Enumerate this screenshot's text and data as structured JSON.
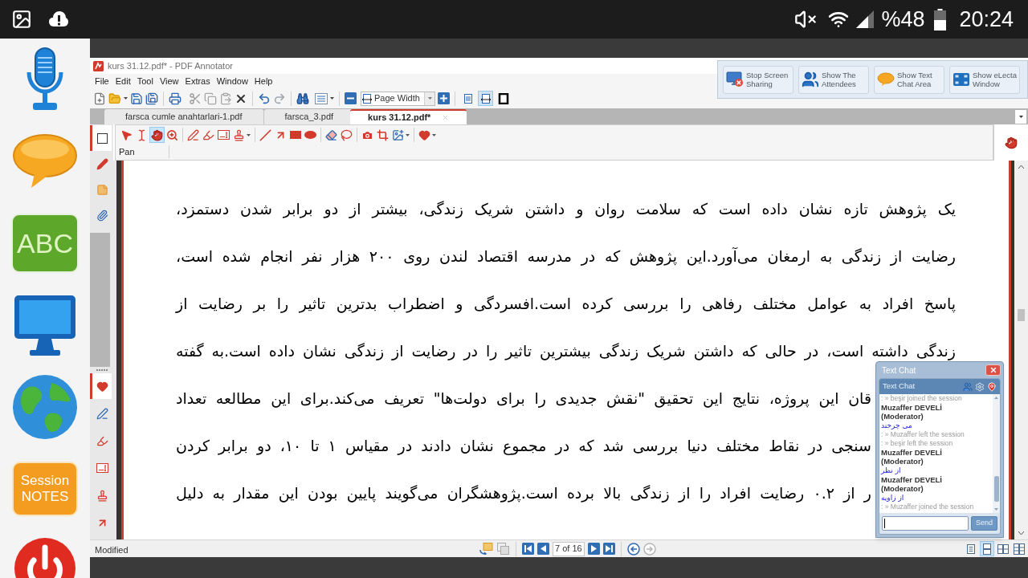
{
  "phone_status": {
    "battery": "%48",
    "time": "20:24"
  },
  "dock": {
    "abc_tile": "ABC",
    "notes_tile": "Session NOTES"
  },
  "window": {
    "title": "kurs 31.12.pdf* - PDF Annotator"
  },
  "menu": [
    "File",
    "Edit",
    "Tool",
    "View",
    "Extras",
    "Window",
    "Help"
  ],
  "toolbar": {
    "zoom_mode": "Page Width",
    "view_buttons": [
      {
        "kind": "single-page",
        "selected": false
      },
      {
        "kind": "page-width",
        "selected": true
      },
      {
        "kind": "full-screen",
        "selected": false
      }
    ]
  },
  "sharing_bar": {
    "buttons": [
      {
        "kind": "stop-sharing",
        "label": "Stop Screen Sharing"
      },
      {
        "kind": "attendees",
        "label": "Show The Attendees"
      },
      {
        "kind": "chat",
        "label": "Show Text Chat Area"
      },
      {
        "kind": "window",
        "label": "Show eLecta Window"
      }
    ]
  },
  "tabs": [
    {
      "label": "farsca cumle anahtarlari-1.pdf",
      "selected": false
    },
    {
      "label": "farsca_3.pdf",
      "selected": false
    },
    {
      "label": "kurs 31.12.pdf*",
      "selected": true
    }
  ],
  "sidebar": {
    "top_tabs": [
      {
        "kind": "page",
        "selected": true
      },
      {
        "kind": "marker",
        "selected": false
      },
      {
        "kind": "note",
        "selected": false
      },
      {
        "kind": "attachment",
        "selected": false
      }
    ],
    "bottom_tabs": [
      {
        "kind": "favorite",
        "selected": true
      },
      {
        "kind": "pen",
        "selected": false
      },
      {
        "kind": "highlighter",
        "selected": false
      },
      {
        "kind": "textbox",
        "selected": false
      },
      {
        "kind": "stamp",
        "selected": false
      },
      {
        "kind": "arrow",
        "selected": false
      }
    ]
  },
  "annotation_toolbar": {
    "groups": [
      [
        {
          "kind": "select",
          "selected": false
        },
        {
          "kind": "text-select",
          "selected": false
        },
        {
          "kind": "pan",
          "selected": true
        },
        {
          "kind": "zoom",
          "selected": false
        }
      ],
      [
        {
          "kind": "pen",
          "selected": false
        },
        {
          "kind": "highlighter",
          "selected": false
        },
        {
          "kind": "textbox",
          "selected": false
        },
        {
          "kind": "stamp",
          "selected": false,
          "menu": true
        }
      ],
      [
        {
          "kind": "line",
          "selected": false
        },
        {
          "kind": "arrow",
          "selected": false
        },
        {
          "kind": "rectangle",
          "selected": false
        },
        {
          "kind": "ellipse",
          "selected": false
        }
      ],
      [
        {
          "kind": "eraser",
          "selected": false
        },
        {
          "kind": "lasso",
          "selected": false
        }
      ],
      [
        {
          "kind": "camera",
          "selected": false
        },
        {
          "kind": "crop",
          "selected": false
        },
        {
          "kind": "image",
          "selected": false,
          "menu": true
        }
      ],
      [
        {
          "kind": "heart",
          "selected": false,
          "menu": true
        }
      ]
    ],
    "tool_label": "Pan"
  },
  "document": {
    "lines": [
      {
        "text": "یک پژوهش تازه نشان داده است که سلامت روان و داشتن شریک زندگی، بیشتر از دو برابر شدن دستمزد،",
        "covered": false
      },
      {
        "text": "رضایت از زندگی به ارمغان می‌آورد.این پژوهش که در مدرسه اقتصاد لندن روی ۲۰۰ هزار نفر انجام شده است،",
        "covered": false
      },
      {
        "text": "پاسخ افراد به عوامل مختلف رفاهی را بررسی کرده است.افسردگی و اضطراب بدترین تاثیر را بر رضایت از",
        "covered": false
      },
      {
        "text": "زندگی داشته است، در حالی که داشتن شریک زندگی بیشترین تاثیر را در رضایت از زندگی نشان داده است.به گفته",
        "covered": false
      },
      {
        "text": "قان این پروژه، نتایج این تحقیق \"نقش جدیدی را برای دولت‌ها\" تعریف می‌کند.برای این مطالعه تعداد",
        "covered": true
      },
      {
        "text": "سنجی در نقاط مختلف دنیا بررسی شد که در مجموع نشان دادند در مقیاس ۱ تا ۱۰، دو برابر کردن",
        "covered": true
      },
      {
        "text": "ر از ۰.۲ رضایت افراد را از زندگی بالا برده است.پژوهشگران می‌گویند پایین بودن این مقدار به دلیل",
        "covered": true
      }
    ]
  },
  "chat": {
    "title": "Text Chat",
    "header": "Text Chat",
    "messages": [
      {
        "kind": "system",
        "text": ": » beşir joined the session"
      },
      {
        "kind": "author",
        "text": "Muzaffer DEVELİ (Moderator)"
      },
      {
        "kind": "message",
        "text": "می چرخند"
      },
      {
        "kind": "system",
        "text": ": » Muzaffer left the session"
      },
      {
        "kind": "system",
        "text": ": » beşir left the session"
      },
      {
        "kind": "author",
        "text": "Muzaffer DEVELİ (Moderator)"
      },
      {
        "kind": "message",
        "text": "از نظر"
      },
      {
        "kind": "author",
        "text": "Muzaffer DEVELİ (Moderator)"
      },
      {
        "kind": "message",
        "text": "از زاویه"
      },
      {
        "kind": "system",
        "text": ": » Muzaffer joined the session"
      }
    ],
    "send_button": "Send"
  },
  "status_bar": {
    "text": "Modified",
    "page": "7 of 16",
    "view_buttons": [
      {
        "kind": "single",
        "selected": false
      },
      {
        "kind": "continuous",
        "selected": true
      },
      {
        "kind": "facing",
        "selected": false
      },
      {
        "kind": "facing-continuous",
        "selected": false
      }
    ]
  }
}
